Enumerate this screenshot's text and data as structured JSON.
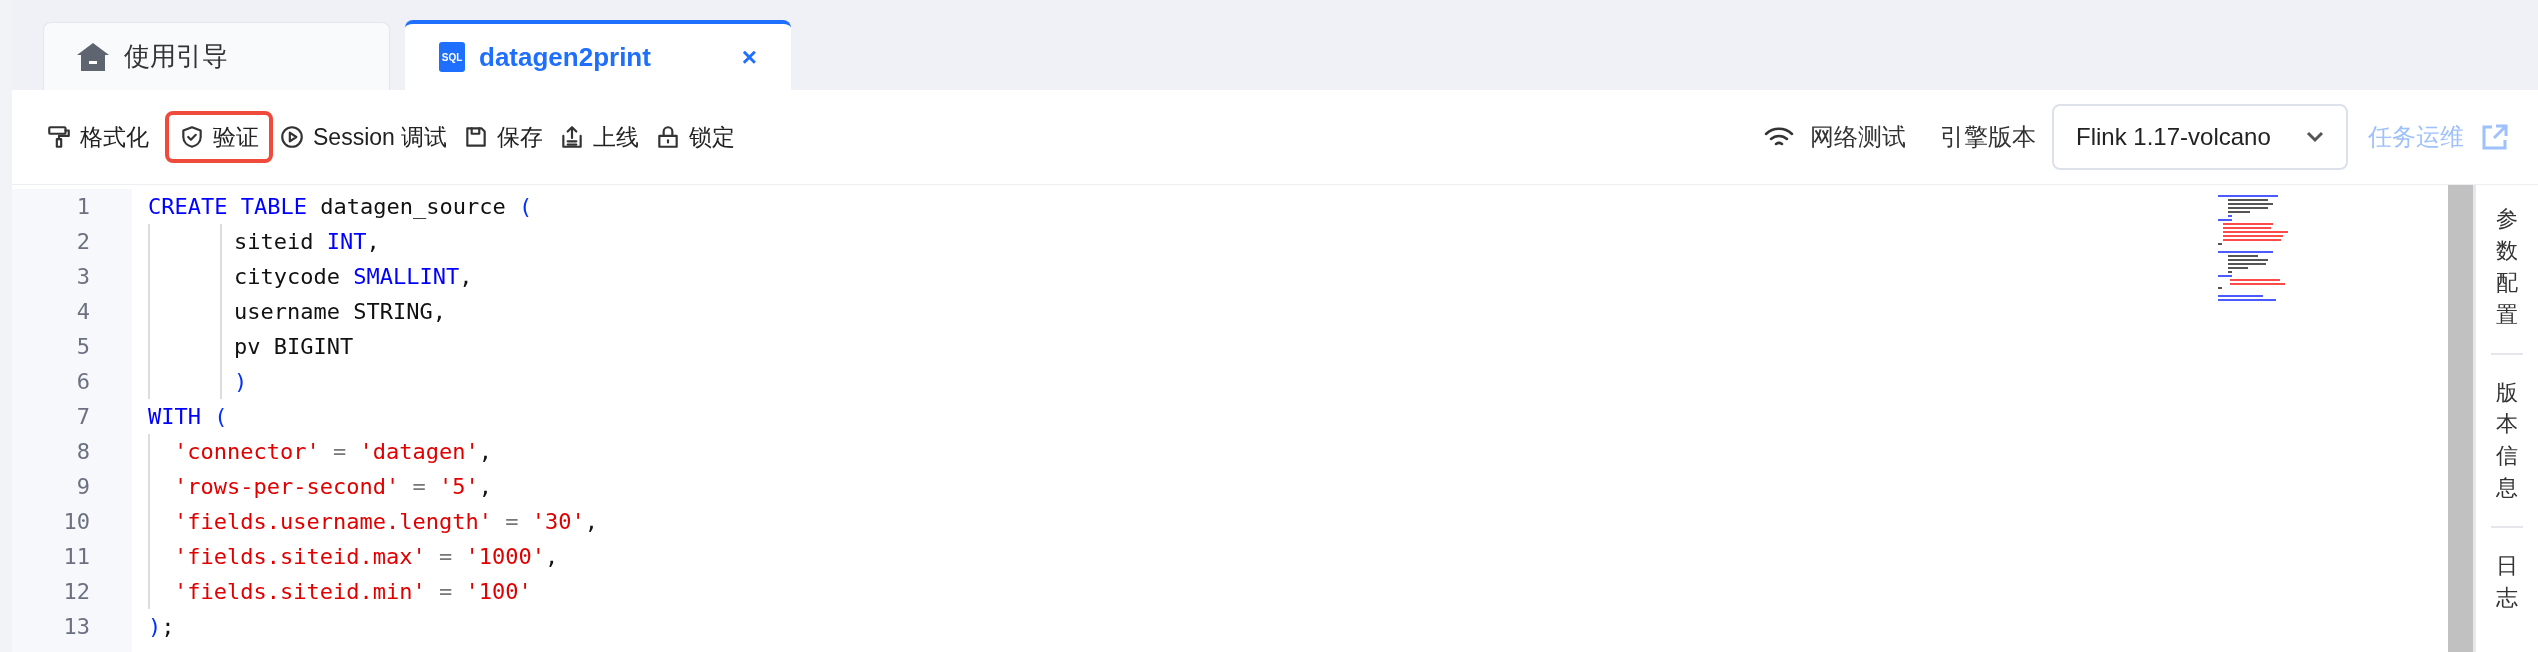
{
  "tabs": [
    {
      "label": "使用引导",
      "selected": false
    },
    {
      "label": "datagen2print",
      "selected": true,
      "badge": "SQL",
      "close": "×"
    }
  ],
  "toolbar": {
    "actions": [
      {
        "label": "格式化",
        "highlighted": false
      },
      {
        "label": "验证",
        "highlighted": true
      },
      {
        "label": "Session 调试",
        "highlighted": false
      },
      {
        "label": "保存",
        "highlighted": false
      },
      {
        "label": "上线",
        "highlighted": false
      },
      {
        "label": "锁定",
        "highlighted": false
      }
    ],
    "network_test": "网络测试",
    "engine_label": "引擎版本",
    "engine_select": {
      "value": "Flink 1.17-volcano"
    },
    "ops_link": {
      "label": "任务运维",
      "disabled": true
    }
  },
  "editor": {
    "lines": [
      {
        "number": "1",
        "kind": "statement",
        "tokens": [
          {
            "kind": "keyword",
            "text": "CREATE TABLE"
          },
          {
            "kind": "plain",
            "text": " datagen_source "
          },
          {
            "kind": "paren",
            "text": "("
          }
        ]
      },
      {
        "number": "2",
        "kind": "column",
        "tokens": [
          {
            "kind": "plain",
            "text": "siteid "
          },
          {
            "kind": "keyword",
            "text": "INT"
          },
          {
            "kind": "plain",
            "text": ","
          }
        ]
      },
      {
        "number": "3",
        "kind": "column",
        "tokens": [
          {
            "kind": "plain",
            "text": "citycode "
          },
          {
            "kind": "keyword",
            "text": "SMALLINT"
          },
          {
            "kind": "plain",
            "text": ","
          }
        ]
      },
      {
        "number": "4",
        "kind": "column",
        "tokens": [
          {
            "kind": "plain",
            "text": "username STRING,"
          }
        ]
      },
      {
        "number": "5",
        "kind": "column",
        "tokens": [
          {
            "kind": "plain",
            "text": "pv BIGINT"
          }
        ]
      },
      {
        "number": "6",
        "kind": "column",
        "tokens": [
          {
            "kind": "paren",
            "text": ")"
          }
        ]
      },
      {
        "number": "7",
        "kind": "statement",
        "tokens": [
          {
            "kind": "keyword",
            "text": "WITH"
          },
          {
            "kind": "paren",
            "text": " ("
          }
        ]
      },
      {
        "number": "8",
        "kind": "option",
        "tokens": [
          {
            "kind": "string",
            "text": "'connector'"
          },
          {
            "kind": "operator",
            "text": " = "
          },
          {
            "kind": "string",
            "text": "'datagen'"
          },
          {
            "kind": "plain",
            "text": ","
          }
        ]
      },
      {
        "number": "9",
        "kind": "option",
        "tokens": [
          {
            "kind": "string",
            "text": "'rows-per-second'"
          },
          {
            "kind": "operator",
            "text": " = "
          },
          {
            "kind": "string",
            "text": "'5'"
          },
          {
            "kind": "plain",
            "text": ","
          }
        ]
      },
      {
        "number": "10",
        "kind": "option",
        "tokens": [
          {
            "kind": "string",
            "text": "'fields.username.length'"
          },
          {
            "kind": "operator",
            "text": " = "
          },
          {
            "kind": "string",
            "text": "'30'"
          },
          {
            "kind": "plain",
            "text": ","
          }
        ]
      },
      {
        "number": "11",
        "kind": "option",
        "tokens": [
          {
            "kind": "string",
            "text": "'fields.siteid.max'"
          },
          {
            "kind": "operator",
            "text": " = "
          },
          {
            "kind": "string",
            "text": "'1000'"
          },
          {
            "kind": "plain",
            "text": ","
          }
        ]
      },
      {
        "number": "12",
        "kind": "option",
        "tokens": [
          {
            "kind": "string",
            "text": "'fields.siteid.min'"
          },
          {
            "kind": "operator",
            "text": " = "
          },
          {
            "kind": "string",
            "text": "'100'"
          }
        ]
      },
      {
        "number": "13",
        "kind": "statement",
        "tokens": [
          {
            "kind": "paren",
            "text": ")"
          },
          {
            "kind": "plain",
            "text": ";"
          }
        ]
      }
    ]
  },
  "side_panel": [
    "参数配置",
    "版本信息",
    "日志"
  ]
}
